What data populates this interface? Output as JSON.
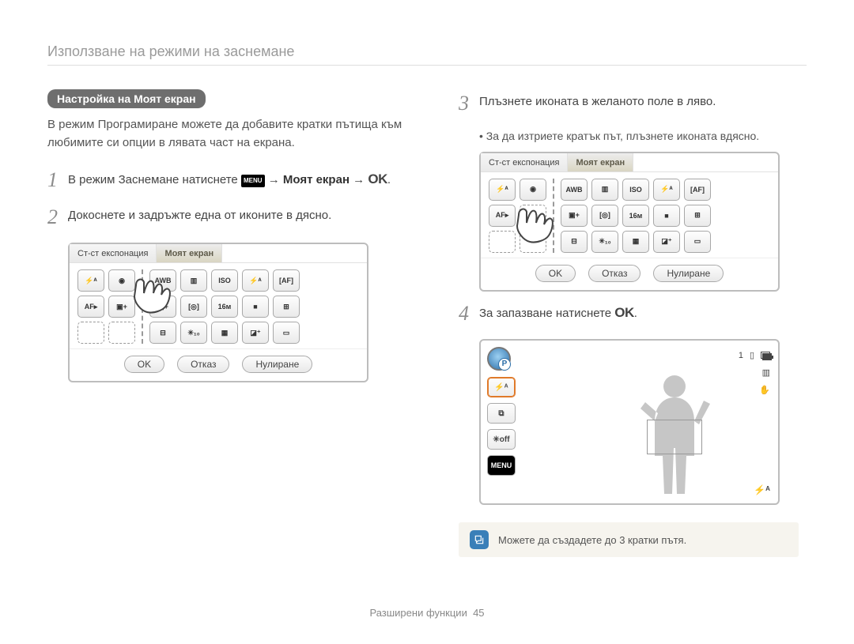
{
  "breadcrumb": "Използване на режими на заснемане",
  "heading_pill": "Настройка на Моят екран",
  "intro": "В режим Програмиране можете да добавите кратки пътища към любимите си опции в лявата част на екрана.",
  "steps": {
    "s1_a": "В режим Заснемане натиснете ",
    "s1_menu": "MENU",
    "s1_b": " → ",
    "s1_bold": "Моят екран",
    "s1_c": " → ",
    "s1_ok": "OK",
    "s1_d": ".",
    "s2": "Докоснете и задръжте една от иконите в дясно.",
    "s3": "Плъзнете иконата в желаното поле в ляво.",
    "s3_sub": "За да изтриете кратък път, плъзнете иконата вдясно.",
    "s4_a": "За запазване натиснете ",
    "s4_ok": "OK",
    "s4_b": "."
  },
  "panel": {
    "tab_left": "Ст-ст експонация",
    "tab_right": "Моят екран",
    "btn_ok": "OK",
    "btn_cancel": "Отказ",
    "btn_reset": "Нулиране",
    "left_icons": [
      "⚡ᴬ",
      "◉",
      "AF▸",
      "▣+",
      " ",
      " "
    ],
    "right_icons_r1": [
      "AWB",
      "▥",
      "ISO",
      "⚡ᴬ",
      "[AF]"
    ],
    "right_icons_r2": [
      "▣+",
      "[◎]",
      "16ᴍ",
      "■",
      "⊞"
    ],
    "right_icons_r3": [
      "⊟",
      "✳₁₀",
      "▦",
      "◪⁺",
      "▭"
    ]
  },
  "viewfinder": {
    "counter": "1",
    "flash": "⚡ᴬ",
    "left_icons": [
      "⚡ᴬ",
      "⧉",
      "✳off"
    ],
    "menu": "MENU",
    "right_icons": [
      "▥",
      "✋"
    ]
  },
  "note": "Можете да създадете до 3 кратки пътя.",
  "footer_label": "Разширени функции",
  "footer_page": "45"
}
